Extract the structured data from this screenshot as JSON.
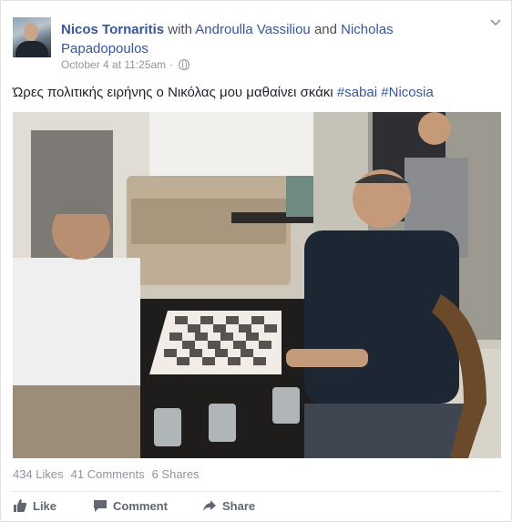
{
  "post": {
    "author": "Nicos Tornaritis",
    "with_text": "with",
    "tagged_1": "Androulla Vassiliou",
    "and_text": "and",
    "tagged_2": "Nicholas Papadopoulos",
    "timestamp": "October 4 at 11:25am",
    "separator": "·",
    "privacy_icon": "globe-icon",
    "text_main": "Ώρες πολιτικής ειρήνης ο Νικόλας μου μαθαίνει σκάκι",
    "hashtag_1": "#sabai",
    "hashtag_2": "#Nicosia"
  },
  "stats": {
    "likes": "434 Likes",
    "comments": "41 Comments",
    "shares": "6 Shares"
  },
  "actions": {
    "like": "Like",
    "comment": "Comment",
    "share": "Share"
  },
  "colors": {
    "link": "#365899",
    "meta": "#90949c",
    "action": "#606770"
  }
}
